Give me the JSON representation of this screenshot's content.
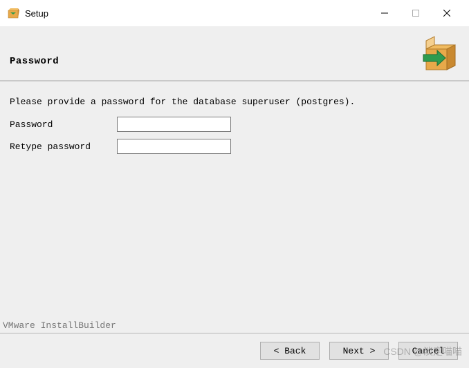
{
  "titlebar": {
    "title": "Setup"
  },
  "header": {
    "title": "Password"
  },
  "content": {
    "instruction": "Please provide a password for the database superuser (postgres).",
    "password_label": "Password",
    "password_value": "",
    "retype_label": "Retype password",
    "retype_value": ""
  },
  "footer": {
    "brand": "VMware InstallBuilder",
    "back_label": "< Back",
    "next_label": "Next >",
    "cancel_label": "Cancel"
  },
  "watermark": "CSDN @淡定喵喵"
}
